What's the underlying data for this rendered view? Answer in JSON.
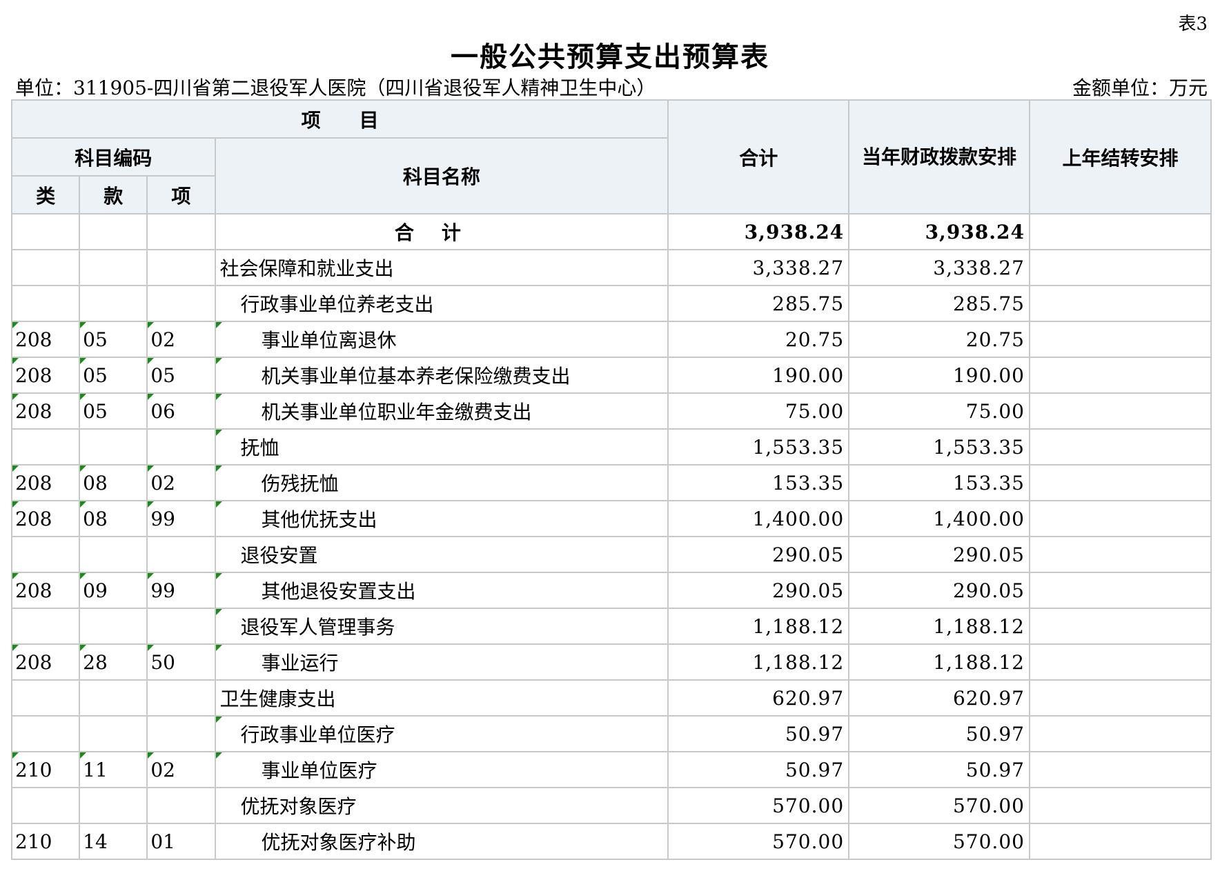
{
  "header": {
    "table_no": "表3",
    "title": "一般公共预算支出预算表",
    "unit": "单位：311905-四川省第二退役军人医院（四川省退役军人精神卫生中心）",
    "amount_unit": "金额单位：万元"
  },
  "columns": {
    "project": "项　　目",
    "subject_code": "科目编码",
    "lei": "类",
    "kuan": "款",
    "xiang": "项",
    "subject_name": "科目名称",
    "total": "合计",
    "current_year": "当年财政拨款安排",
    "prior_year": "上年结转安排"
  },
  "total_row": {
    "label": "合计",
    "total": "3,938.24",
    "current_year": "3,938.24",
    "prior_year": ""
  },
  "rows": [
    {
      "lei": "",
      "kuan": "",
      "xiang": "",
      "name": "社会保障和就业支出",
      "level": 0,
      "total": "3,338.27",
      "current_year": "3,338.27",
      "prior_year": "",
      "marker": false
    },
    {
      "lei": "",
      "kuan": "",
      "xiang": "",
      "name": "行政事业单位养老支出",
      "level": 1,
      "total": "285.75",
      "current_year": "285.75",
      "prior_year": "",
      "marker": false
    },
    {
      "lei": "208",
      "kuan": "05",
      "xiang": "02",
      "name": "事业单位离退休",
      "level": 2,
      "total": "20.75",
      "current_year": "20.75",
      "prior_year": "",
      "marker": true
    },
    {
      "lei": "208",
      "kuan": "05",
      "xiang": "05",
      "name": "机关事业单位基本养老保险缴费支出",
      "level": 2,
      "total": "190.00",
      "current_year": "190.00",
      "prior_year": "",
      "marker": true
    },
    {
      "lei": "208",
      "kuan": "05",
      "xiang": "06",
      "name": "机关事业单位职业年金缴费支出",
      "level": 2,
      "total": "75.00",
      "current_year": "75.00",
      "prior_year": "",
      "marker": true
    },
    {
      "lei": "",
      "kuan": "",
      "xiang": "",
      "name": "抚恤",
      "level": 1,
      "total": "1,553.35",
      "current_year": "1,553.35",
      "prior_year": "",
      "marker": "name"
    },
    {
      "lei": "208",
      "kuan": "08",
      "xiang": "02",
      "name": "伤残抚恤",
      "level": 2,
      "total": "153.35",
      "current_year": "153.35",
      "prior_year": "",
      "marker": true
    },
    {
      "lei": "208",
      "kuan": "08",
      "xiang": "99",
      "name": "其他优抚支出",
      "level": 2,
      "total": "1,400.00",
      "current_year": "1,400.00",
      "prior_year": "",
      "marker": true
    },
    {
      "lei": "",
      "kuan": "",
      "xiang": "",
      "name": "退役安置",
      "level": 1,
      "total": "290.05",
      "current_year": "290.05",
      "prior_year": "",
      "marker": false
    },
    {
      "lei": "208",
      "kuan": "09",
      "xiang": "99",
      "name": "其他退役安置支出",
      "level": 2,
      "total": "290.05",
      "current_year": "290.05",
      "prior_year": "",
      "marker": true
    },
    {
      "lei": "",
      "kuan": "",
      "xiang": "",
      "name": "退役军人管理事务",
      "level": 1,
      "total": "1,188.12",
      "current_year": "1,188.12",
      "prior_year": "",
      "marker": "name"
    },
    {
      "lei": "208",
      "kuan": "28",
      "xiang": "50",
      "name": "事业运行",
      "level": 2,
      "total": "1,188.12",
      "current_year": "1,188.12",
      "prior_year": "",
      "marker": true
    },
    {
      "lei": "",
      "kuan": "",
      "xiang": "",
      "name": "卫生健康支出",
      "level": 0,
      "total": "620.97",
      "current_year": "620.97",
      "prior_year": "",
      "marker": false
    },
    {
      "lei": "",
      "kuan": "",
      "xiang": "",
      "name": "行政事业单位医疗",
      "level": 1,
      "total": "50.97",
      "current_year": "50.97",
      "prior_year": "",
      "marker": "name"
    },
    {
      "lei": "210",
      "kuan": "11",
      "xiang": "02",
      "name": "事业单位医疗",
      "level": 2,
      "total": "50.97",
      "current_year": "50.97",
      "prior_year": "",
      "marker": true
    },
    {
      "lei": "",
      "kuan": "",
      "xiang": "",
      "name": "优抚对象医疗",
      "level": 1,
      "total": "570.00",
      "current_year": "570.00",
      "prior_year": "",
      "marker": false
    },
    {
      "lei": "210",
      "kuan": "14",
      "xiang": "01",
      "name": "优抚对象医疗补助",
      "level": 2,
      "total": "570.00",
      "current_year": "570.00",
      "prior_year": "",
      "marker": false
    }
  ]
}
